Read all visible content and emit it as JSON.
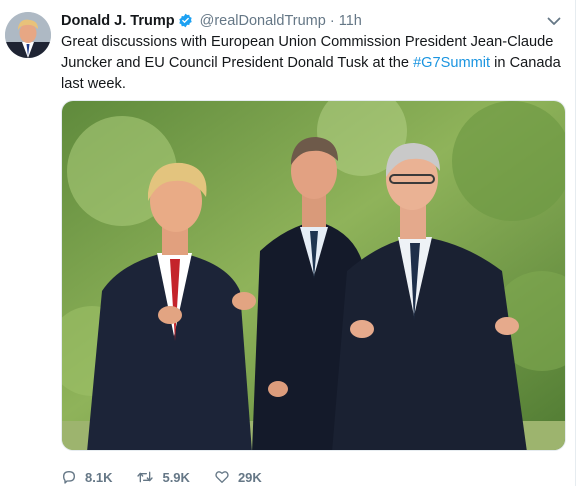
{
  "tweet": {
    "author": {
      "display_name": "Donald J. Trump",
      "handle": "@realDonaldTrump",
      "verified": true
    },
    "separator": "·",
    "time": "11h",
    "text_before": "Great discussions with European Union Commission President Jean-Claude Juncker and EU Council President Donald Tusk at the ",
    "hashtag": "#G7Summit",
    "text_after": " in Canada last week.",
    "actions": {
      "replies": "8.1K",
      "retweets": "5.9K",
      "likes": "29K"
    }
  },
  "colors": {
    "link": "#1b95e0",
    "secondary_text": "#657786",
    "verified_badge": "#1da1f2"
  },
  "icons": [
    "verified-badge-icon",
    "chevron-down-icon",
    "reply-icon",
    "retweet-icon",
    "like-icon"
  ]
}
